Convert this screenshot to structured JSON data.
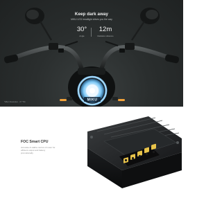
{
  "hero": {
    "title": "Keep dark away",
    "subtitle": "MIKU LED headlight drives you the way",
    "stats": [
      {
        "value": "30°",
        "caption": "Angle"
      },
      {
        "value": "12m",
        "caption": "Radiation distance"
      }
    ],
    "headlight_brand": "MIKU",
    "footnote": "*Effect illustration - 37 °5%"
  },
  "cpu": {
    "title": "FOC Smart CPU",
    "description": "Accurate & stable control of motor for efficient output and battery promotionally"
  },
  "colors": {
    "hero_bg": "#2a2e2e",
    "headlight_ring": "#9fd8ff",
    "turn_signal": "#f2a23a",
    "connector": "#e8c34a"
  }
}
